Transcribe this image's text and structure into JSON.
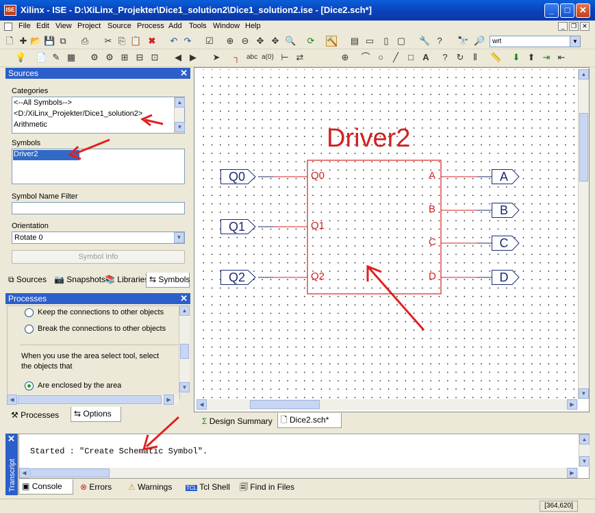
{
  "window": {
    "title": "Xilinx - ISE - D:\\XiLinx_Projekter\\Dice1_solution2\\Dice1_solution2.ise - [Dice2.sch*]",
    "app_icon": "ISE"
  },
  "menu": [
    "File",
    "Edit",
    "View",
    "Project",
    "Source",
    "Process",
    "Add",
    "Tools",
    "Window",
    "Help"
  ],
  "toolbar": {
    "search_value": "wrt"
  },
  "sources_panel": {
    "title": "Sources",
    "categories_label": "Categories",
    "categories": [
      "<--All Symbols-->",
      "<D:/XiLinx_Projekter/Dice1_solution2>",
      "Arithmetic"
    ],
    "symbols_label": "Symbols",
    "symbols": [
      "Driver2"
    ],
    "filter_label": "Symbol Name Filter",
    "filter_value": "",
    "orientation_label": "Orientation",
    "orientation_value": "Rotate 0",
    "symbol_info_button": "Symbol Info",
    "tabs": [
      "Sources",
      "Snapshots",
      "Libraries",
      "Symbols"
    ],
    "active_tab": "Symbols"
  },
  "processes_panel": {
    "title": "Processes",
    "option_keep": "Keep the connections to other objects",
    "option_break": "Break the connections to other objects",
    "area_text": "When you use the area select tool, select the objects that",
    "option_enclosed": "Are enclosed by the area",
    "tabs": [
      "Processes",
      "Options"
    ],
    "active_tab": "Options"
  },
  "schematic": {
    "component_name": "Driver2",
    "input_ports": [
      "Q0",
      "Q1",
      "Q2"
    ],
    "output_ports": [
      "A",
      "B",
      "C",
      "D"
    ],
    "input_pins": [
      "Q0",
      "Q1",
      "Q2"
    ],
    "output_pins": [
      "A",
      "B",
      "C",
      "D"
    ],
    "colors": {
      "component": "#d42020",
      "port": "#1b2a70",
      "annotation": "#e02020"
    }
  },
  "editor_tabs": [
    "Design Summary",
    "Dice2.sch*"
  ],
  "active_editor_tab": "Dice2.sch*",
  "transcript": {
    "side_label": "Transcript",
    "line": "Started : \"Create Schematic Symbol\".",
    "tabs": [
      "Console",
      "Errors",
      "Warnings",
      "Tcl Shell",
      "Find in Files"
    ],
    "active_tab": "Console"
  },
  "status": {
    "coords": "[364,620]"
  }
}
